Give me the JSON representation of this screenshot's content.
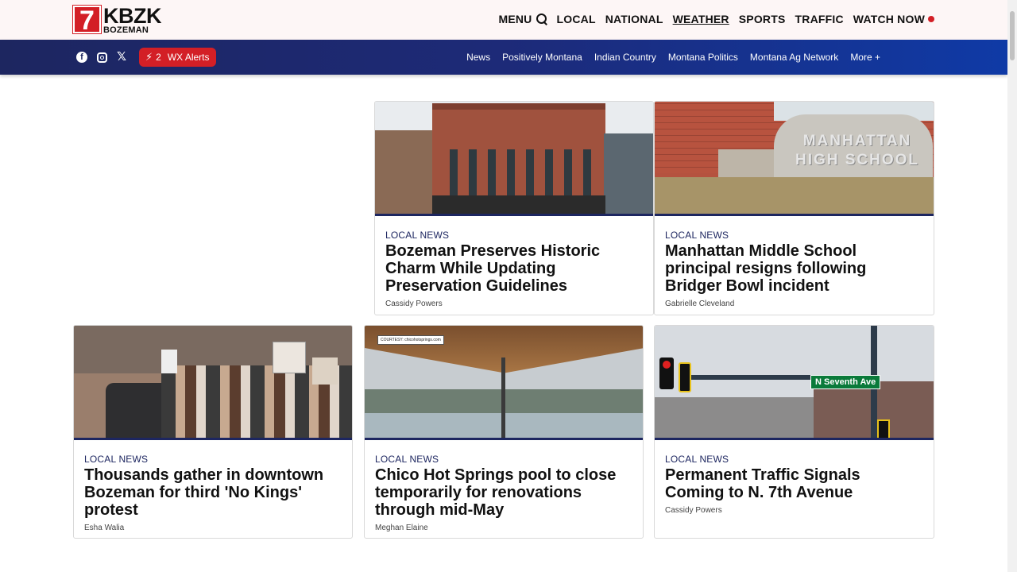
{
  "header": {
    "logo": {
      "number": "7",
      "call_sign": "KBZK",
      "city": "BOZEMAN"
    },
    "nav": {
      "menu_label": "MENU",
      "items": [
        "LOCAL",
        "NATIONAL",
        "WEATHER",
        "SPORTS",
        "TRAFFIC"
      ],
      "watch_now": "WATCH NOW"
    }
  },
  "subbar": {
    "social": [
      "facebook-icon",
      "instagram-icon",
      "x-icon"
    ],
    "alerts": {
      "count": "2",
      "label": "WX Alerts"
    },
    "links": [
      "News",
      "Positively Montana",
      "Indian Country",
      "Montana Politics",
      "Montana Ag Network",
      "More +"
    ]
  },
  "cards": [
    {
      "kicker": "LOCAL NEWS",
      "headline": "Bozeman Preserves Historic Charm While Updating Preservation Guidelines",
      "author": "Cassidy Powers"
    },
    {
      "kicker": "LOCAL NEWS",
      "headline": "Manhattan Middle School principal resigns following Bridger Bowl incident",
      "author": "Gabrielle Cleveland",
      "image_text": [
        "MANHATTAN",
        "HIGH SCHOOL"
      ]
    },
    {
      "kicker": "LOCAL NEWS",
      "headline": "Thousands gather in downtown Bozeman for third 'No Kings' protest",
      "author": "Esha Walia"
    },
    {
      "kicker": "LOCAL NEWS",
      "headline": "Chico Hot Springs pool to close temporarily for renovations through mid-May",
      "author": "Meghan Elaine",
      "image_text": "COURTESY: chicohotsprings.com"
    },
    {
      "kicker": "LOCAL NEWS",
      "headline": "Permanent Traffic Signals Coming to N. 7th Avenue",
      "author": "Cassidy Powers",
      "image_text": "N Seventh Ave"
    }
  ],
  "colors": {
    "brand_red": "#d31f26",
    "navy": "#1d2660",
    "blue": "#0f3aa6"
  }
}
